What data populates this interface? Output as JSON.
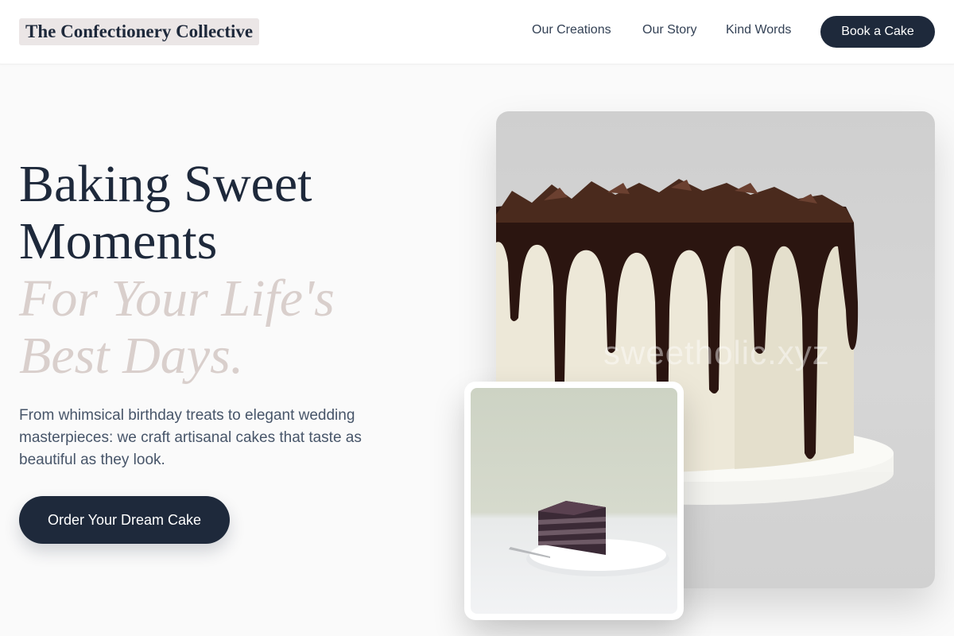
{
  "header": {
    "brand": "The Confectionery Collective",
    "nav": [
      "Our Creations",
      "Our Story",
      "Kind Words"
    ],
    "cta": "Book a Cake"
  },
  "hero": {
    "title_lines": [
      "Baking Sweet",
      "Moments"
    ],
    "accent_lines": [
      "For Your Life's",
      "Best Days."
    ],
    "description": "From whimsical birthday treats to elegant wedding masterpieces: we craft artisanal cakes that taste as beautiful as they look.",
    "cta": "Order Your Dream Cake"
  },
  "images": {
    "main": "chocolate-drip-cake-photo",
    "main_watermark": "sweetholic.xyz",
    "secondary": "chocolate-cake-slice-photo"
  },
  "colors": {
    "primary": "#1e293b",
    "accent_text": "#d9cfcc",
    "background": "#fafafa"
  }
}
